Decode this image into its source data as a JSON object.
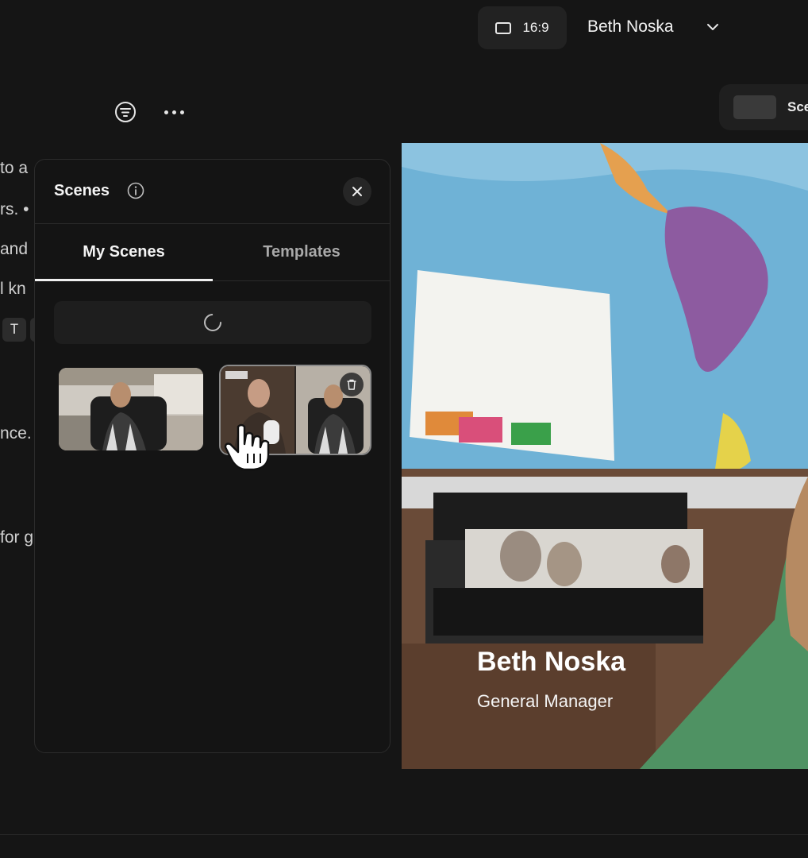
{
  "topbar": {
    "aspect_ratio": "16:9",
    "user_name": "Beth Noska"
  },
  "scene_pill": {
    "label": "Sce"
  },
  "background_text": {
    "line1": "to a",
    "line2": "rs. •",
    "line3": "and",
    "line4": "l kn",
    "chip": "T",
    "line5": "nce.",
    "line6": "for g"
  },
  "panel": {
    "title": "Scenes",
    "tabs": [
      {
        "label": "My Scenes",
        "active": true
      },
      {
        "label": "Templates",
        "active": false
      }
    ]
  },
  "video": {
    "name": "Beth Noska",
    "role": "General Manager"
  }
}
